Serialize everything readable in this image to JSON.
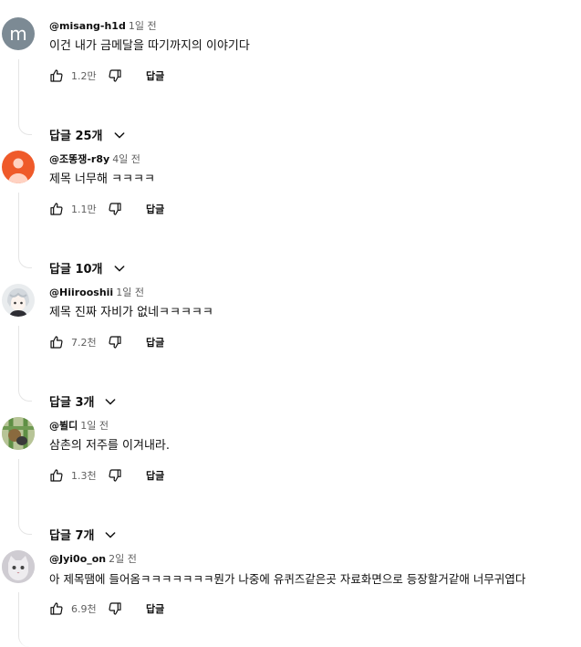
{
  "comments": [
    {
      "author": "@misang-h1d",
      "time": "1일 전",
      "text": "이건 내가 금메달을 따기까지의 이야기다",
      "likes": "1.2만",
      "reply_label": "답글",
      "replies_label": "답글 25개",
      "avatar": {
        "type": "letter",
        "letter": "m",
        "bg": "#7c8a94"
      }
    },
    {
      "author": "@조똥쟁-r8y",
      "time": "4일 전",
      "text": "제목 너무해 ㅋㅋㅋㅋ",
      "likes": "1.1만",
      "reply_label": "답글",
      "replies_label": "답글 10개",
      "avatar": {
        "type": "person-icon",
        "bg": "#ef5a2a"
      }
    },
    {
      "author": "@Hiirooshii",
      "time": "1일 전",
      "text": "제목 진짜 자비가 없네ㅋㅋㅋㅋㅋ",
      "likes": "7.2천",
      "reply_label": "답글",
      "replies_label": "답글 3개",
      "avatar": {
        "type": "anime-character",
        "bg": "#e9ecee"
      }
    },
    {
      "author": "@뷜디",
      "time": "1일 전",
      "text": "삼촌의 저주를 이겨내라.",
      "likes": "1.3천",
      "reply_label": "답글",
      "replies_label": "답글 7개",
      "avatar": {
        "type": "photo",
        "bg": "#a9b98a"
      }
    },
    {
      "author": "@Jyi0o_on",
      "time": "2일 전",
      "text": "아 제목땜에 들어옴ㅋㅋㅋㅋㅋㅋㅋ뭔가 나중에 유퀴즈같은곳 자료화면으로 등장할거같애 너무귀엽다",
      "likes": "6.9천",
      "reply_label": "답글",
      "avatar": {
        "type": "cat-photo",
        "bg": "#d7d4d8"
      }
    }
  ],
  "icons": {
    "like": "thumbs-up-icon",
    "dislike": "thumbs-down-icon",
    "expand": "chevron-down-icon"
  }
}
